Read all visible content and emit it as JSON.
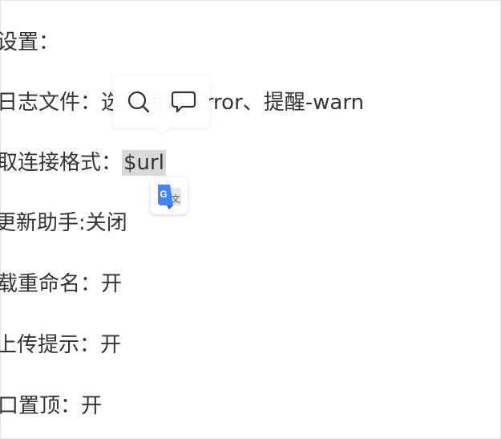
{
  "settings": {
    "lines": [
      "设置：",
      "日志文件：选择错误-Error、提醒-warn",
      "取连接格式：",
      "更新助手:关闭",
      "载重命名：开",
      "上传提示：开",
      "口置顶：开"
    ],
    "selected_value": "$url"
  },
  "toolbar": {
    "search_icon": "search-icon",
    "comment_icon": "comment-icon"
  },
  "translate": {
    "g_letter": "G",
    "wen_char": "文",
    "brand_color": "#4285F4"
  }
}
